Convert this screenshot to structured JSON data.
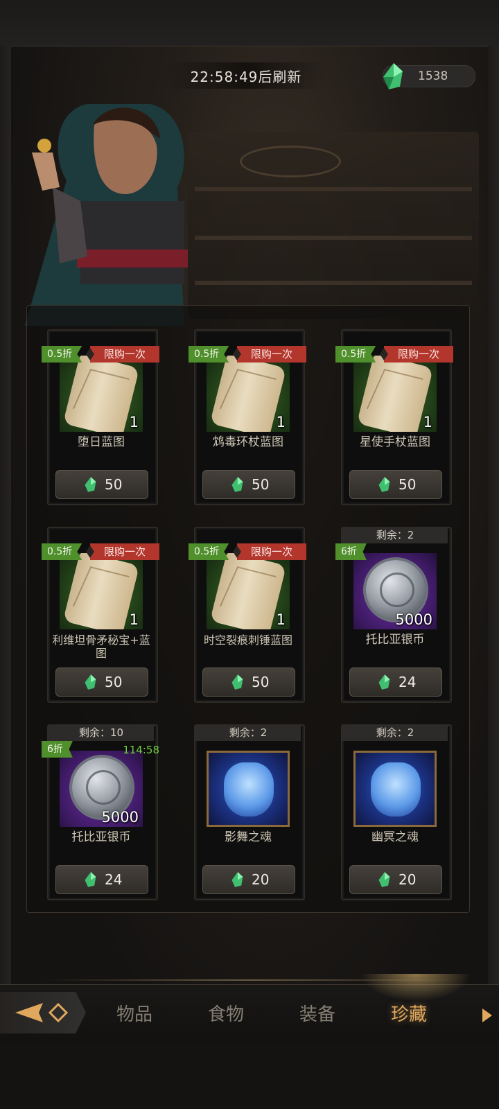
{
  "header": {
    "refresh_countdown": "22:58:49后刷新",
    "currency_amount": "1538",
    "currency_icon": "green-crystal-icon"
  },
  "shop": {
    "items": [
      {
        "discount": "0.5折",
        "limit": "限购一次",
        "qty": "1",
        "name": "堕日蓝图",
        "price": "50",
        "art": "scroll",
        "rarity": "green"
      },
      {
        "discount": "0.5折",
        "limit": "限购一次",
        "qty": "1",
        "name": "鸩毒环杖蓝图",
        "price": "50",
        "art": "scroll",
        "rarity": "green"
      },
      {
        "discount": "0.5折",
        "limit": "限购一次",
        "qty": "1",
        "name": "星使手杖蓝图",
        "price": "50",
        "art": "scroll",
        "rarity": "green"
      },
      {
        "discount": "0.5折",
        "limit": "限购一次",
        "qty": "1",
        "name": "利维坦骨矛秘宝+蓝图",
        "price": "50",
        "art": "scroll",
        "rarity": "green"
      },
      {
        "discount": "0.5折",
        "limit": "限购一次",
        "qty": "1",
        "name": "时空裂痕刺锤蓝图",
        "price": "50",
        "art": "scroll",
        "rarity": "green"
      },
      {
        "remaining": "剩余：2",
        "discount": "6折",
        "qty": "5000",
        "name": "托比亚银币",
        "price": "24",
        "art": "coin",
        "rarity": "purple"
      },
      {
        "remaining": "剩余：10",
        "discount": "6折",
        "timer": "114:58",
        "qty": "5000",
        "name": "托比亚银币",
        "price": "24",
        "art": "coin",
        "rarity": "purple"
      },
      {
        "remaining": "剩余：2",
        "name": "影舞之魂",
        "price": "20",
        "art": "wolf",
        "rarity": "blue"
      },
      {
        "remaining": "剩余：2",
        "name": "幽冥之魂",
        "price": "20",
        "art": "ghost",
        "rarity": "blue"
      }
    ]
  },
  "tabs": {
    "items": [
      "物品",
      "食物",
      "装备",
      "珍藏"
    ],
    "active": "珍藏"
  },
  "colors": {
    "accent": "#e0a85c",
    "discount_green": "#4f8f2c",
    "limit_red": "#b3362d",
    "timer_green": "#6fcf3f"
  }
}
